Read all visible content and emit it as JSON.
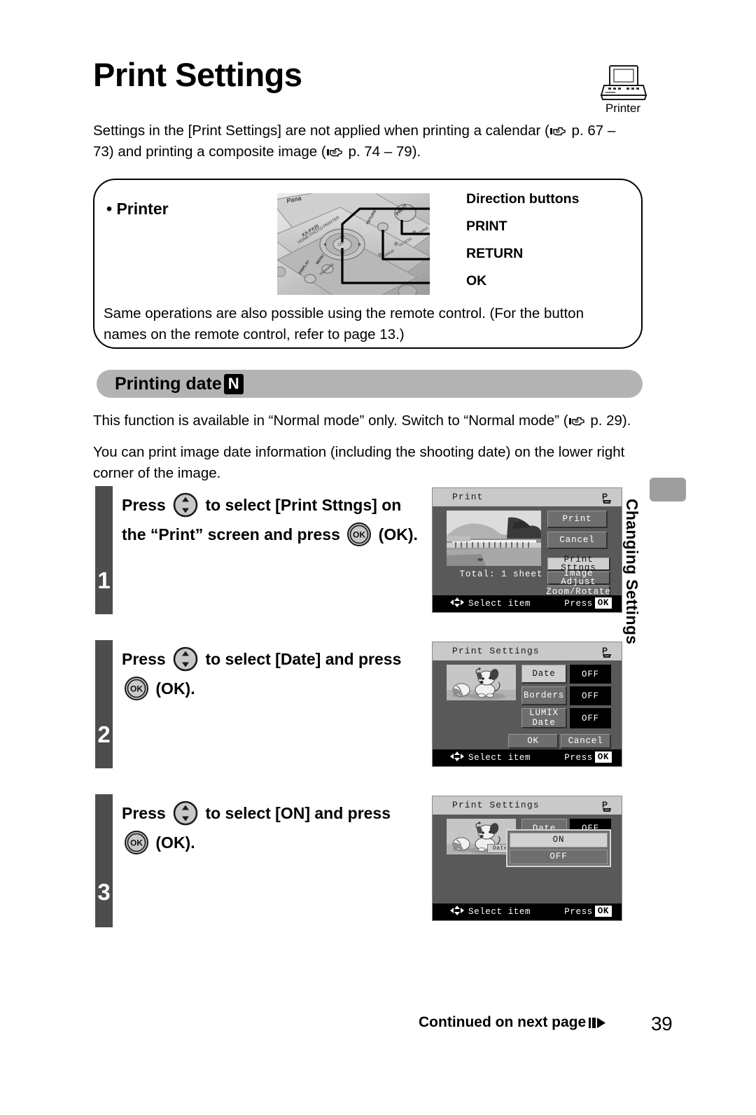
{
  "header": {
    "title": "Print Settings",
    "printer_badge_label": "Printer",
    "printer_badge_icon": "printer-icon"
  },
  "intro": {
    "text_a": "Settings in the [Print Settings] are not applied when printing a calendar (",
    "ref_a": " p. 67",
    "text_b": " – 73) and printing a composite image (",
    "ref_b": " p. 74 – 79).",
    "pointer_icon": "pointing-hand-icon"
  },
  "note_box": {
    "printer_label": "• Printer",
    "photo_name": "printer-control-panel-photo",
    "callouts": [
      {
        "label": "Direction buttons"
      },
      {
        "label": "PRINT"
      },
      {
        "label": "RETURN"
      },
      {
        "label": "OK"
      }
    ],
    "footer_text": "Same operations are also possible using the remote control. (For the button names on the remote control, refer to page 13.)"
  },
  "section": {
    "heading": "Printing date",
    "heading_chip": "N",
    "para_normal_mode_a": "This function is available in “Normal mode” only. Switch to “Normal mode” (",
    "para_normal_mode_b": " p. 29).",
    "para_date_info": "You can print image date information (including the shooting date) on the lower right corner of the image."
  },
  "steps": [
    {
      "number": "1",
      "text_a": "Press ",
      "text_b": " to select [Print Sttngs] on the “Print” screen and press ",
      "text_c": " (OK).",
      "dpad_icon": "direction-pad-icon",
      "ok_icon": "ok-button-icon"
    },
    {
      "number": "2",
      "text_a": "Press ",
      "text_b": " to select [Date] and press ",
      "text_c": " (OK).",
      "dpad_icon": "direction-pad-icon",
      "ok_icon": "ok-button-icon"
    },
    {
      "number": "3",
      "text_a": "Press ",
      "text_b": " to select [ON] and press ",
      "text_c": " (OK).",
      "dpad_icon": "direction-pad-icon",
      "ok_icon": "ok-button-icon"
    }
  ],
  "lcd_screens": [
    {
      "title": "Print",
      "status_icon": "printer-status-icon",
      "thumbnail": "landscape-bridge-photo",
      "total_label": "Total:",
      "total_value": "1 sheet",
      "buttons": [
        {
          "label": "Print",
          "selected": false
        },
        {
          "label": "Cancel",
          "selected": false
        },
        {
          "label": "Print Sttngs",
          "selected": true
        },
        {
          "label": "Image Adjust",
          "selected": false
        },
        {
          "label": "Zoom/Rotate",
          "selected": false
        }
      ],
      "footer_left": "Select item",
      "footer_right": "Press",
      "footer_ok": "OK"
    },
    {
      "title": "Print Settings",
      "status_icon": "printer-status-icon",
      "thumbnail": "puppy-and-ball-photo",
      "rows": [
        {
          "label": "Date",
          "value": "OFF",
          "selected": true
        },
        {
          "label": "Borders",
          "value": "OFF",
          "selected": false
        },
        {
          "label": "LUMIX\nDate",
          "value": "OFF",
          "selected": false
        }
      ],
      "ok_label": "OK",
      "cancel_label": "Cancel",
      "footer_left": "Select item",
      "footer_right": "Press",
      "footer_ok": "OK"
    },
    {
      "title": "Print Settings",
      "status_icon": "printer-status-icon",
      "thumbnail": "puppy-and-ball-photo",
      "ghost_row": {
        "label": "Date",
        "value": "OFF"
      },
      "date_tag": "Date",
      "options": [
        {
          "label": "ON",
          "selected": true
        },
        {
          "label": "OFF",
          "selected": false
        }
      ],
      "footer_left": "Select item",
      "footer_right": "Press",
      "footer_ok": "OK"
    }
  ],
  "side_tab": {
    "label": "Changing Settings"
  },
  "footer": {
    "continued": "Continued on next page",
    "continued_icon": "next-page-arrow-icon",
    "page_number": "39"
  },
  "colors": {
    "step_bar": "#4d4d4d",
    "section_bar": "#b3b3b3",
    "side_tab": "#9e9e9e",
    "lcd_body": "#595959",
    "lcd_title_bar": "#c9c9c9",
    "lcd_footer": "#000000",
    "lcd_selected": "#cfcfcf"
  }
}
